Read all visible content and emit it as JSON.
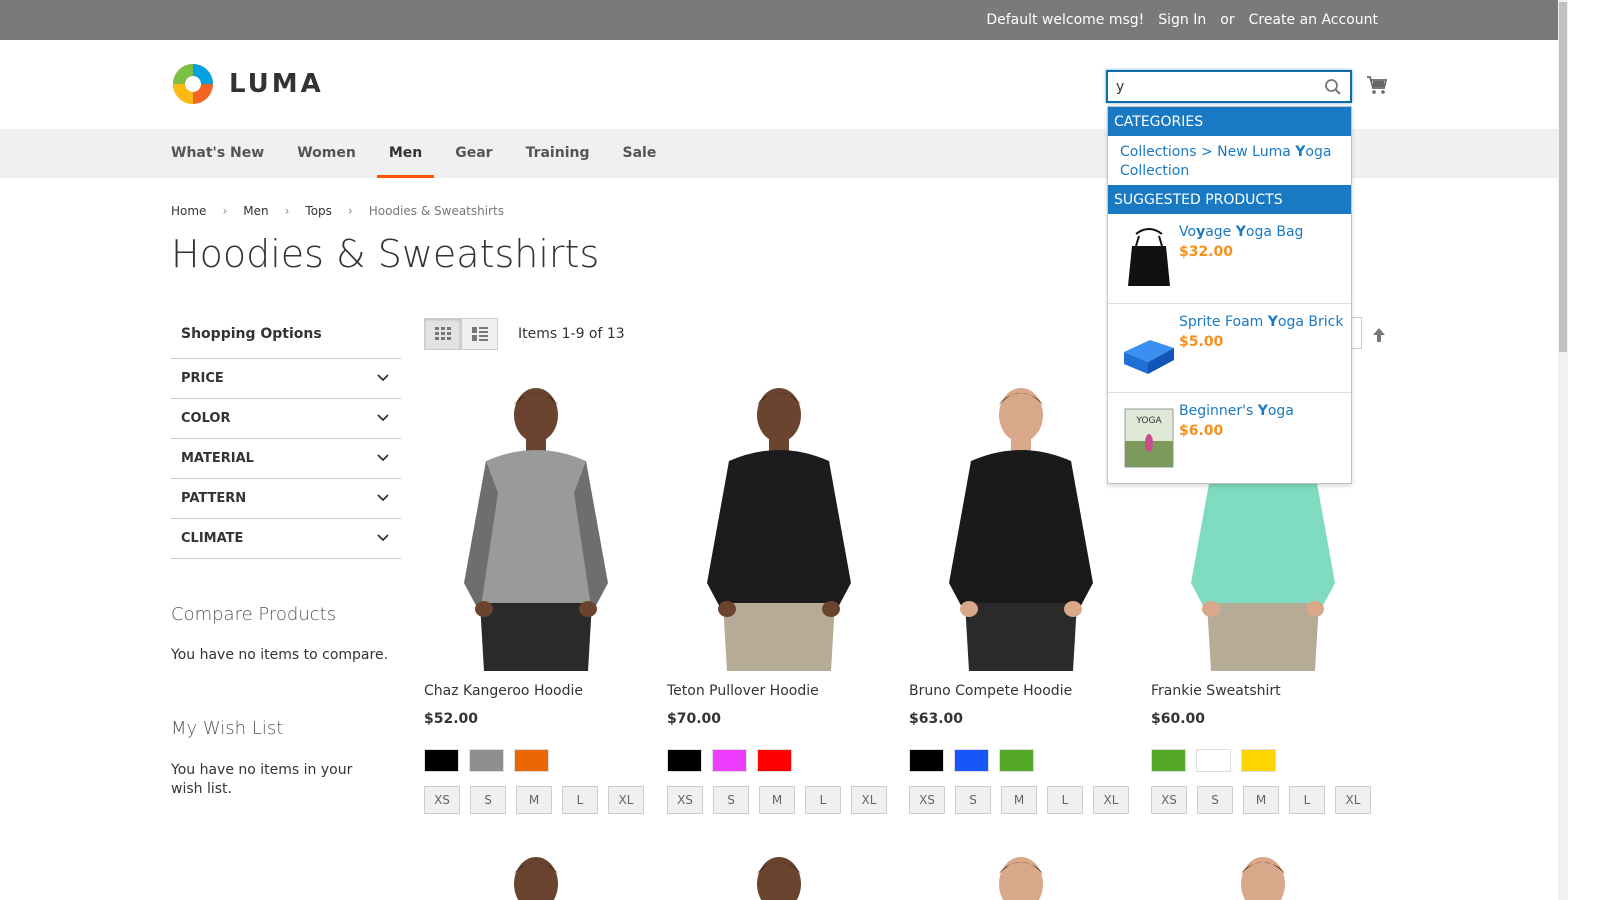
{
  "topbar": {
    "welcome": "Default welcome msg!",
    "sign_in": "Sign In",
    "or": "or",
    "create_account": "Create an Account"
  },
  "header": {
    "logo_text": "LUMA",
    "search_value": "y"
  },
  "nav": {
    "items": [
      "What's New",
      "Women",
      "Men",
      "Gear",
      "Training",
      "Sale"
    ],
    "active": "Men"
  },
  "breadcrumb": [
    "Home",
    "Men",
    "Tops",
    "Hoodies & Sweatshirts"
  ],
  "page_title": "Hoodies & Sweatshirts",
  "sidebar": {
    "title": "Shopping Options",
    "filters": [
      "PRICE",
      "COLOR",
      "MATERIAL",
      "PATTERN",
      "CLIMATE"
    ],
    "compare_title": "Compare Products",
    "compare_text": "You have no items to compare.",
    "wish_title": "My Wish List",
    "wish_text": "You have no items in your wish list."
  },
  "toolbar": {
    "items_count": "Items 1-9 of 13"
  },
  "products": [
    {
      "name": "Chaz Kangeroo Hoodie",
      "price": "$52.00",
      "colors": [
        "#000000",
        "#8f8f8f",
        "#eb6703"
      ],
      "sizes": [
        "XS",
        "S",
        "M",
        "L",
        "XL"
      ],
      "shirt": "#9a9a9a",
      "sleeve": "#6e6e6e",
      "skin": "#6b4430",
      "pants": "#2a2a2a"
    },
    {
      "name": "Teton Pullover Hoodie",
      "price": "$70.00",
      "colors": [
        "#000000",
        "#ef3dff",
        "#ff0000"
      ],
      "sizes": [
        "XS",
        "S",
        "M",
        "L",
        "XL"
      ],
      "shirt": "#1c1c1e",
      "sleeve": "#1c1c1e",
      "skin": "#6b4430",
      "pants": "#b5ab96"
    },
    {
      "name": "Bruno Compete Hoodie",
      "price": "$63.00",
      "colors": [
        "#000000",
        "#1857f7",
        "#53a828"
      ],
      "sizes": [
        "XS",
        "S",
        "M",
        "L",
        "XL"
      ],
      "shirt": "#1a1a1a",
      "sleeve": "#1a1a1a",
      "skin": "#d9a78a",
      "pants": "#2a2a2a"
    },
    {
      "name": "Frankie Sweatshirt",
      "price": "$60.00",
      "colors": [
        "#53a828",
        "#ffffff",
        "#ffd500"
      ],
      "sizes": [
        "XS",
        "S",
        "M",
        "L",
        "XL"
      ],
      "shirt": "#7fdcc0",
      "sleeve": "#7fdcc0",
      "skin": "#d9a78a",
      "pants": "#b5ab96"
    }
  ],
  "autocomplete": {
    "categories_header": "Categories",
    "category_prefix": "Collections > New Luma ",
    "category_highlight": "Y",
    "category_rest": "oga",
    "category_line2": "Collection",
    "products_header": "Suggested Products",
    "suggestions": [
      {
        "pre": "Vo",
        "hl1": "y",
        "mid": "age ",
        "hl2": "Y",
        "post": "oga Bag",
        "price": "$32.00",
        "thumb": "bag"
      },
      {
        "pre": "Sprite Foam ",
        "hl1": "",
        "mid": "",
        "hl2": "Y",
        "post": "oga Brick",
        "price": "$5.00",
        "thumb": "brick"
      },
      {
        "pre": "Beginner's ",
        "hl1": "",
        "mid": "",
        "hl2": "Y",
        "post": "oga",
        "price": "$6.00",
        "thumb": "dvd"
      }
    ]
  },
  "thumbs": {
    "dvd_caption": "YOGA"
  },
  "colors": {
    "accent_blue": "#1979c3",
    "nav_active_underline": "#ff5501",
    "price_orange": "#f6901c",
    "topbar_bg": "#7a7a7a"
  }
}
